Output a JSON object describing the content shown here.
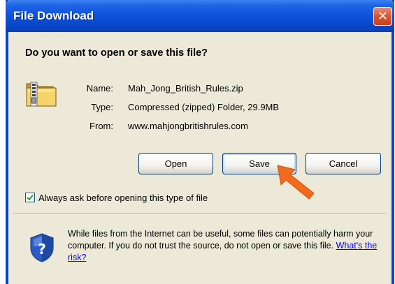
{
  "window": {
    "title": "File Download",
    "close_glyph": "✕"
  },
  "dialog": {
    "question": "Do you want to open or save this file?",
    "file_icon": "zip-folder-icon",
    "info": {
      "name_label": "Name:",
      "name_value": "Mah_Jong_British_Rules.zip",
      "type_label": "Type:",
      "type_value": "Compressed (zipped) Folder, 29.9MB",
      "from_label": "From:",
      "from_value": "www.mahjongbritishrules.com"
    },
    "buttons": {
      "open": "Open",
      "save": "Save",
      "cancel": "Cancel"
    },
    "checkbox": {
      "label": "Always ask before opening this type of file",
      "checked": true
    },
    "warning": {
      "text": "While files from the Internet can be useful, some files can potentially harm your computer. If you do not trust the source, do not open or save this file.",
      "link": "What's the risk?"
    },
    "annotation_arrow_color": "#f26a1b"
  },
  "colors": {
    "titlebar": "#0c4fd8",
    "dialog_bg": "#ece9d8",
    "close_button": "#d9552f",
    "link": "#0000ee"
  }
}
